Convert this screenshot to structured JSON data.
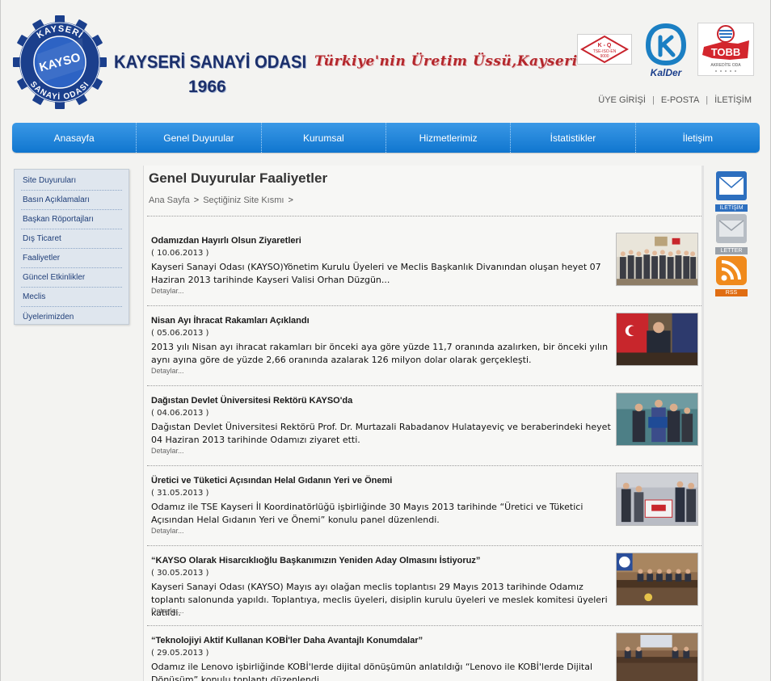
{
  "header": {
    "logo_text_top": "KAYSO",
    "logo_text_ring_1": "KAYSERİ",
    "logo_text_ring_2": "SANAYİ ODASI",
    "org_name": "KAYSERİ SANAYİ ODASI",
    "founded_year": "1966",
    "slogan": "Türkiye'nin Üretim Üssü,Kayseri",
    "certificates": {
      "tse_line1": "K - Q",
      "tse_line2": "TSE-ISO-EN",
      "tse_line3": "9000",
      "kalder_label": "KalDer",
      "tobb_label": "TOBB",
      "tobb_sub": "AKREDİTE ODA"
    }
  },
  "top_links": [
    "ÜYE GİRİŞİ",
    "E-POSTA",
    "İLETİŞİM"
  ],
  "nav": [
    "Anasayfa",
    "Genel Duyurular",
    "Kurumsal",
    "Hizmetlerimiz",
    "İstatistikler",
    "İletişim"
  ],
  "sidebar": [
    "Site Duyuruları",
    "Basın Açıklamaları",
    "Başkan Röportajları",
    "Dış Ticaret",
    "Faaliyetler",
    "Güncel Etkinlikler",
    "Meclis",
    "Üyelerimizden"
  ],
  "main": {
    "title": "Genel Duyurular Faaliyetler",
    "breadcrumb": [
      "Ana Sayfa",
      "Seçtiğiniz Site Kısmı"
    ],
    "breadcrumb_arrow": ">",
    "more_label": "Detaylar..."
  },
  "news": [
    {
      "title": "Odamızdan Hayırlı Olsun Ziyaretleri",
      "date": "( 10.06.2013 )",
      "text": "Kayseri Sanayi Odası (KAYSO)Yönetim Kurulu Üyeleri ve Meclis Başkanlık Divanından oluşan heyet 07 Haziran 2013 tarihinde Kayseri Valisi Orhan Düzgün..."
    },
    {
      "title": "Nisan Ayı İhracat Rakamları Açıklandı",
      "date": "( 05.06.2013 )",
      "text": "2013 yılı Nisan ayı ihracat rakamları bir önceki aya göre yüzde 11,7 oranında azalırken, bir önceki yılın aynı ayına göre de yüzde 2,66 oranında azalarak 126 milyon dolar olarak gerçekleşti."
    },
    {
      "title": "Dağıstan Devlet Üniversitesi Rektörü KAYSO'da",
      "date": "( 04.06.2013 )",
      "text": "Dağıstan Devlet Üniversitesi Rektörü Prof. Dr. Murtazali Rabadanov Hulatayeviç ve beraberindeki heyet 04 Haziran 2013 tarihinde Odamızı ziyaret etti."
    },
    {
      "title": "Üretici ve Tüketici Açısından Helal Gıdanın Yeri ve Önemi",
      "date": "( 31.05.2013 )",
      "text": "Odamız ile TSE Kayseri İl Koordinatörlüğü işbirliğinde 30 Mayıs 2013 tarihinde “Üretici ve Tüketici Açısından Helal Gıdanın Yeri ve Önemi” konulu panel düzenlendi."
    },
    {
      "title": "“KAYSO Olarak Hisarcıklıoğlu Başkanımızın Yeniden Aday Olmasını İstiyoruz”",
      "date": "( 30.05.2013 )",
      "text": "Kayseri Sanayi Odası (KAYSO) Mayıs ayı olağan meclis toplantısı 29 Mayıs 2013 tarihinde Odamız toplantı salonunda yapıldı. Toplantıya, meclis üyeleri, disiplin kurulu üyeleri ve meslek komitesi üyeleri katıldı."
    },
    {
      "title": "“Teknolojiyi Aktif Kullanan KOBİ'ler Daha Avantajlı Konumdalar”",
      "date": "( 29.05.2013 )",
      "text": "Odamız ile Lenovo işbirliğinde KOBİ'lerde dijital dönüşümün anlatıldığı “Lenovo ile KOBİ'lerde Dijital Dönüşüm” konulu toplantı düzenlendi."
    }
  ],
  "right_icons": [
    "İLETİŞİM",
    "LETTER",
    "RSS"
  ],
  "colors": {
    "nav_blue": "#1a82d8",
    "brand_navy": "#1b2f6b",
    "slogan_red": "#b3272c",
    "rss_orange": "#f08a1c"
  }
}
